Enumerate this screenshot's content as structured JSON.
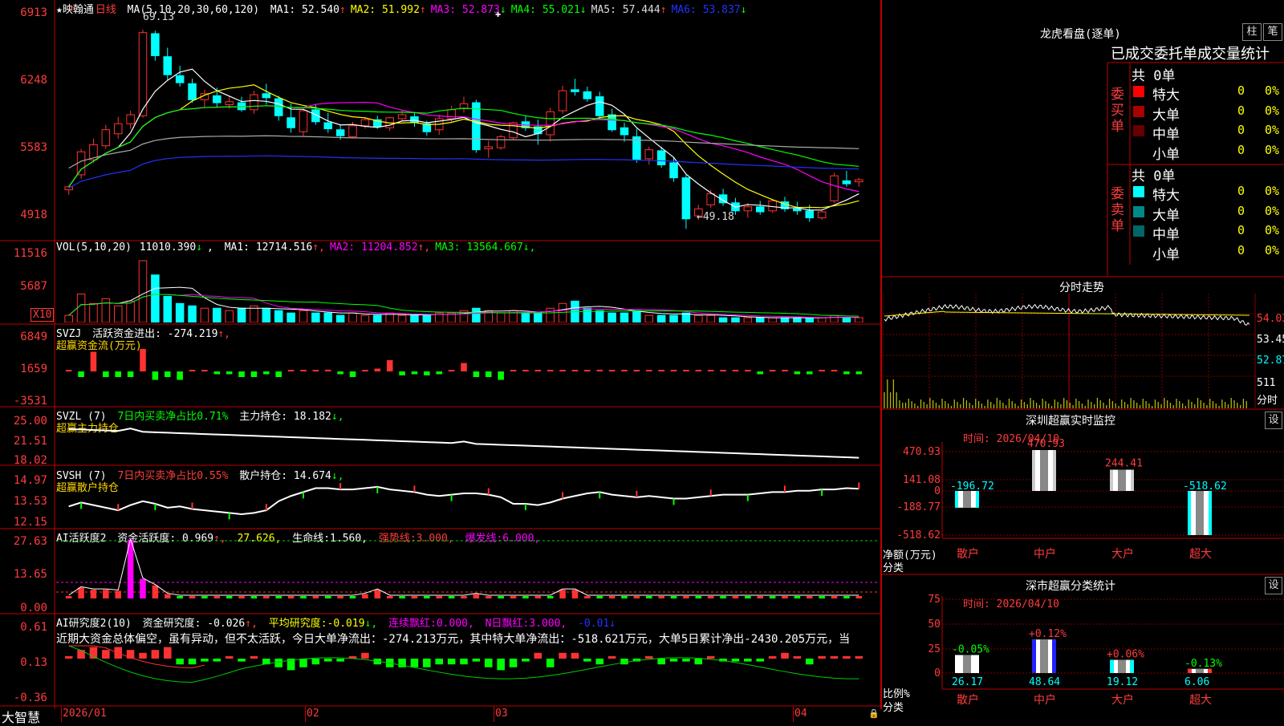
{
  "colors": {
    "up": "#ff3232",
    "down": "#00ffff",
    "grid": "#c00000",
    "ma1": "#ffffff",
    "ma2": "#ffff00",
    "ma3": "#ff00ff",
    "ma4": "#00ff00",
    "ma5": "#aaaaaa",
    "ma6": "#2233ff"
  },
  "main": {
    "title": "★映翰通",
    "period": "日线",
    "ma_label": "MA(5,10,20,30,60,120)",
    "ma": [
      {
        "name": "MA1:",
        "value": "52.540",
        "arrow": "↑",
        "color": "#ffffff"
      },
      {
        "name": "MA2:",
        "value": "51.992",
        "arrow": "↑",
        "color": "#ffff00"
      },
      {
        "name": "MA3:",
        "value": "52.873",
        "arrow": "↓",
        "color": "#ff00ff"
      },
      {
        "name": "MA4:",
        "value": "55.021",
        "arrow": "↓",
        "color": "#00ff00"
      },
      {
        "name": "MA5:",
        "value": "57.444",
        "arrow": "↑",
        "color": "#dddddd"
      },
      {
        "name": "MA6:",
        "value": "53.837",
        "arrow": "↓",
        "color": "#2233ff"
      }
    ],
    "y_ticks": [
      "6913",
      "6248",
      "5583",
      "4918"
    ],
    "high_label": "69.13",
    "low_label": "←49.18"
  },
  "vol": {
    "label": "VOL(5,10,20)",
    "value": "11010.390",
    "arrow": "↓",
    "ma": [
      {
        "name": "MA1:",
        "value": "12714.516",
        "arrow": "↑",
        "color": "#ffffff"
      },
      {
        "name": "MA2:",
        "value": "11204.852",
        "arrow": "↑",
        "color": "#ff00ff"
      },
      {
        "name": "MA3:",
        "value": "13564.667",
        "arrow": "↓",
        "color": "#00ff00"
      }
    ],
    "y_ticks": [
      "11516",
      "5687"
    ],
    "unit": "X10"
  },
  "svzj": {
    "label": "SVZJ",
    "sub": "活跃资金进出:",
    "value": "-274.219",
    "arrow": "↑,",
    "title": "超赢资金流(万元)",
    "y_ticks": [
      "6849",
      "1659",
      "-3531"
    ]
  },
  "svzl": {
    "label": "SVZL (7)",
    "pct": "7日内买卖净占比0.71%",
    "hold_label": "主力持仓:",
    "hold": "18.182",
    "arrow": "↓,",
    "title": "超赢主力持仓",
    "y_ticks": [
      "25.00",
      "21.51",
      "18.02"
    ]
  },
  "svsh": {
    "label": "SVSH (7)",
    "pct": "7日内买卖净占比0.55%",
    "hold_label": "散户持仓:",
    "hold": "14.674",
    "arrow": "↓,",
    "title": "超赢散户持仓",
    "y_ticks": [
      "14.97",
      "13.53",
      "12.15"
    ]
  },
  "ai1": {
    "label": "AI活跃度2",
    "a_label": "资金活跃度:",
    "a_val": "0.969",
    "a_arrow": "↑,",
    "b_val": "27.626,",
    "c_label": "生命线:",
    "c_val": "1.560,",
    "d_label": "强势线:",
    "d_val": "3.000,",
    "e_label": "爆发线:",
    "e_val": "6.000,",
    "y_ticks": [
      "27.63",
      "13.65",
      "0.00"
    ]
  },
  "ai2": {
    "label": "AI研究度2(10)",
    "a_label": "资金研究度:",
    "a_val": "-0.026",
    "a_arrow": "↑,",
    "b_label": "平均研究度:",
    "b_val": "-0.019",
    "b_arrow": "↓,",
    "c_label": "连续飘红:",
    "c_val": "0.000,",
    "d_label": "N日飘红:",
    "d_val": "3.000,",
    "e_val": "-0.01",
    "e_arrow": "↓",
    "commentary": "近期大资金总体偏空，虽有异动，但不太活跃，今日大单净流出：-274.213万元，其中特大单净流出：-518.621万元，大单5日累计净出-2430.205万元，当",
    "y_ticks": [
      "0.61",
      "0.13",
      "-0.36"
    ]
  },
  "xaxis": {
    "labels": [
      "2026/01",
      "02",
      "03",
      "04"
    ],
    "brand": "大智慧"
  },
  "right": {
    "longhu": {
      "title": "龙虎看盘(逐单)",
      "btn1": "柱",
      "btn2": "笔",
      "subtitle": "已成交委托单成交量统计",
      "buy": {
        "side": "委买单",
        "total": "共 0单",
        "rows": [
          {
            "name": "特大",
            "v": "0",
            "p": "0%",
            "c": "#ff0000"
          },
          {
            "name": "大单",
            "v": "0",
            "p": "0%",
            "c": "#aa0000"
          },
          {
            "name": "中单",
            "v": "0",
            "p": "0%",
            "c": "#660000"
          },
          {
            "name": "小单",
            "v": "0",
            "p": "0%",
            "c": "#000000"
          }
        ]
      },
      "sell": {
        "side": "委卖单",
        "total": "共 0单",
        "rows": [
          {
            "name": "特大",
            "v": "0",
            "p": "0%",
            "c": "#00ffff"
          },
          {
            "name": "大单",
            "v": "0",
            "p": "0%",
            "c": "#008888"
          },
          {
            "name": "中单",
            "v": "0",
            "p": "0%",
            "c": "#006666"
          },
          {
            "name": "小单",
            "v": "0",
            "p": "0%",
            "c": "#000000"
          }
        ]
      }
    },
    "fenshi": {
      "title": "分时走势",
      "y_ticks": [
        "54.03",
        "53.45",
        "52.87"
      ],
      "vol_tick": "511",
      "unit": "分时"
    },
    "monitor": {
      "title": "深圳超赢实时监控",
      "btn": "设",
      "time": "时间: 2026/04/10",
      "y_ticks": [
        "470.93",
        "141.08",
        "0",
        "-188.77",
        "-518.62"
      ],
      "ylabel": "净额(万元)",
      "xlabel": "分类",
      "categories": [
        "散户",
        "中户",
        "大户",
        "超大"
      ],
      "values": [
        -196.72,
        470.93,
        244.41,
        -518.62
      ],
      "value_labels": [
        "-196.72",
        "470.93",
        "244.41",
        "-518.62"
      ]
    },
    "classify": {
      "title": "深市超赢分类统计",
      "btn": "设",
      "time": "时间: 2026/04/10",
      "y_ticks": [
        "75",
        "50",
        "25",
        "0"
      ],
      "ylabel": "比例%",
      "xlabel": "分类",
      "categories": [
        "散户",
        "中户",
        "大户",
        "超大"
      ],
      "values": [
        26.17,
        48.64,
        19.12,
        6.06
      ],
      "value_labels": [
        "26.17",
        "48.64",
        "19.12",
        "6.06"
      ],
      "changes": [
        "-0.05%",
        "+0.12%",
        "+0.06%",
        "-0.13%"
      ]
    }
  },
  "chart_data": {
    "type": "candlestick",
    "title": "映翰通 日线",
    "ohlc": [
      [
        53.1,
        53.5,
        52.6,
        53.4
      ],
      [
        54.6,
        57.2,
        54.2,
        56.9
      ],
      [
        56.1,
        58.2,
        55.8,
        57.6
      ],
      [
        57.5,
        59.6,
        57.2,
        59.1
      ],
      [
        58.7,
        60.4,
        58.2,
        59.7
      ],
      [
        59.7,
        61.0,
        59.2,
        60.6
      ],
      [
        60.5,
        69.1,
        60.3,
        68.8
      ],
      [
        68.7,
        69.0,
        66.0,
        66.5
      ],
      [
        66.4,
        67.3,
        64.1,
        64.6
      ],
      [
        64.5,
        65.5,
        63.4,
        63.8
      ],
      [
        63.7,
        64.2,
        61.8,
        62.1
      ],
      [
        62.1,
        63.1,
        61.3,
        62.7
      ],
      [
        62.5,
        63.3,
        61.4,
        61.8
      ],
      [
        61.6,
        62.4,
        61.2,
        61.9
      ],
      [
        61.8,
        62.4,
        60.9,
        61.1
      ],
      [
        61.1,
        63.0,
        60.7,
        62.6
      ],
      [
        62.7,
        63.7,
        61.6,
        62.3
      ],
      [
        62.2,
        62.5,
        60.0,
        60.5
      ],
      [
        60.3,
        61.7,
        58.8,
        59.3
      ],
      [
        58.9,
        61.2,
        58.5,
        61.0
      ],
      [
        61.1,
        61.6,
        59.6,
        59.9
      ],
      [
        59.8,
        60.8,
        58.8,
        59.2
      ],
      [
        59.1,
        59.6,
        58.1,
        58.5
      ],
      [
        58.4,
        59.9,
        58.3,
        59.5
      ],
      [
        59.5,
        60.3,
        59.2,
        60.1
      ],
      [
        60.1,
        60.5,
        59.2,
        59.4
      ],
      [
        59.3,
        60.4,
        59.0,
        60.3
      ],
      [
        60.2,
        61.1,
        60.0,
        60.6
      ],
      [
        60.4,
        60.9,
        59.4,
        59.8
      ],
      [
        59.7,
        60.0,
        58.5,
        58.9
      ],
      [
        59.1,
        60.6,
        58.6,
        60.2
      ],
      [
        60.2,
        61.5,
        59.9,
        61.1
      ],
      [
        61.2,
        62.4,
        60.8,
        61.7
      ],
      [
        61.8,
        62.1,
        56.8,
        57.1
      ],
      [
        57.2,
        58.0,
        56.3,
        57.4
      ],
      [
        57.3,
        58.6,
        57.1,
        58.4
      ],
      [
        58.3,
        59.9,
        58.1,
        59.8
      ],
      [
        59.9,
        60.5,
        59.0,
        59.3
      ],
      [
        59.4,
        60.1,
        57.6,
        58.7
      ],
      [
        58.6,
        61.3,
        57.9,
        60.9
      ],
      [
        61.0,
        63.5,
        60.7,
        63.0
      ],
      [
        63.1,
        64.2,
        62.5,
        62.9
      ],
      [
        62.9,
        63.4,
        61.9,
        62.2
      ],
      [
        62.4,
        62.9,
        60.2,
        60.5
      ],
      [
        60.6,
        61.2,
        58.9,
        59.1
      ],
      [
        59.3,
        59.8,
        57.9,
        58.6
      ],
      [
        58.4,
        59.2,
        55.8,
        56.1
      ],
      [
        56.2,
        57.4,
        55.6,
        57.1
      ],
      [
        57.0,
        57.4,
        55.3,
        55.6
      ],
      [
        55.8,
        56.3,
        53.9,
        54.3
      ],
      [
        54.3,
        54.6,
        49.2,
        50.2
      ],
      [
        50.5,
        51.6,
        50.1,
        51.2
      ],
      [
        51.6,
        53.1,
        51.3,
        52.7
      ],
      [
        52.6,
        53.2,
        51.5,
        51.8
      ],
      [
        51.8,
        52.3,
        50.6,
        51.0
      ],
      [
        51.0,
        51.8,
        50.3,
        51.4
      ],
      [
        51.4,
        52.0,
        50.6,
        50.9
      ],
      [
        51.0,
        52.2,
        50.8,
        52.0
      ],
      [
        51.9,
        52.4,
        50.9,
        51.2
      ],
      [
        51.2,
        51.9,
        50.6,
        51.0
      ],
      [
        51.0,
        51.6,
        49.9,
        50.3
      ],
      [
        50.3,
        51.1,
        50.1,
        50.9
      ],
      [
        52.0,
        54.8,
        51.8,
        54.5
      ],
      [
        54.0,
        55.0,
        53.4,
        53.7
      ],
      [
        53.9,
        54.3,
        53.4,
        54.1
      ]
    ],
    "x": [
      "2026/01",
      "02",
      "03",
      "04"
    ],
    "ylim": [
      48.5,
      70.3
    ]
  }
}
